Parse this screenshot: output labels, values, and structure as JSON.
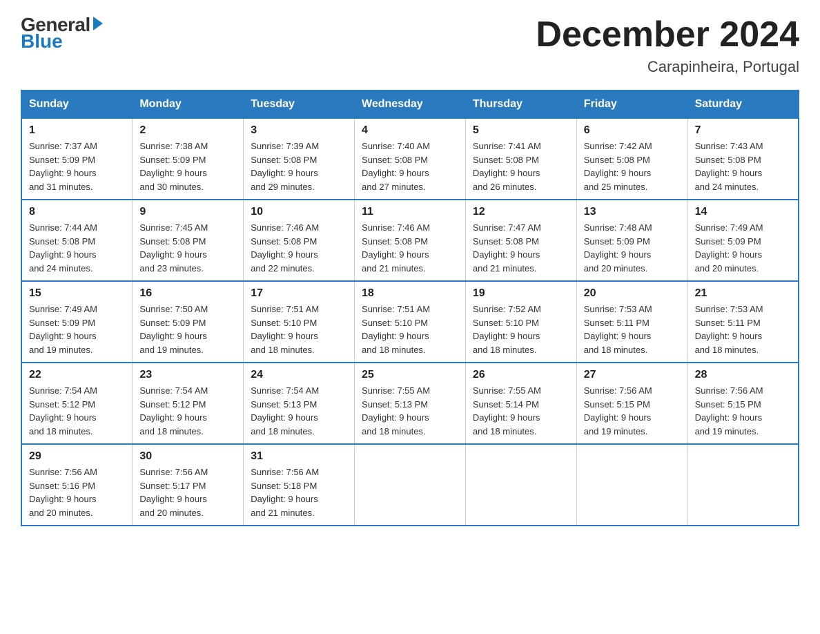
{
  "logo": {
    "general": "General",
    "blue": "Blue"
  },
  "title": "December 2024",
  "subtitle": "Carapinheira, Portugal",
  "days_header": [
    "Sunday",
    "Monday",
    "Tuesday",
    "Wednesday",
    "Thursday",
    "Friday",
    "Saturday"
  ],
  "weeks": [
    [
      {
        "day": "1",
        "sunrise": "7:37 AM",
        "sunset": "5:09 PM",
        "daylight": "9 hours and 31 minutes."
      },
      {
        "day": "2",
        "sunrise": "7:38 AM",
        "sunset": "5:09 PM",
        "daylight": "9 hours and 30 minutes."
      },
      {
        "day": "3",
        "sunrise": "7:39 AM",
        "sunset": "5:08 PM",
        "daylight": "9 hours and 29 minutes."
      },
      {
        "day": "4",
        "sunrise": "7:40 AM",
        "sunset": "5:08 PM",
        "daylight": "9 hours and 27 minutes."
      },
      {
        "day": "5",
        "sunrise": "7:41 AM",
        "sunset": "5:08 PM",
        "daylight": "9 hours and 26 minutes."
      },
      {
        "day": "6",
        "sunrise": "7:42 AM",
        "sunset": "5:08 PM",
        "daylight": "9 hours and 25 minutes."
      },
      {
        "day": "7",
        "sunrise": "7:43 AM",
        "sunset": "5:08 PM",
        "daylight": "9 hours and 24 minutes."
      }
    ],
    [
      {
        "day": "8",
        "sunrise": "7:44 AM",
        "sunset": "5:08 PM",
        "daylight": "9 hours and 24 minutes."
      },
      {
        "day": "9",
        "sunrise": "7:45 AM",
        "sunset": "5:08 PM",
        "daylight": "9 hours and 23 minutes."
      },
      {
        "day": "10",
        "sunrise": "7:46 AM",
        "sunset": "5:08 PM",
        "daylight": "9 hours and 22 minutes."
      },
      {
        "day": "11",
        "sunrise": "7:46 AM",
        "sunset": "5:08 PM",
        "daylight": "9 hours and 21 minutes."
      },
      {
        "day": "12",
        "sunrise": "7:47 AM",
        "sunset": "5:08 PM",
        "daylight": "9 hours and 21 minutes."
      },
      {
        "day": "13",
        "sunrise": "7:48 AM",
        "sunset": "5:09 PM",
        "daylight": "9 hours and 20 minutes."
      },
      {
        "day": "14",
        "sunrise": "7:49 AM",
        "sunset": "5:09 PM",
        "daylight": "9 hours and 20 minutes."
      }
    ],
    [
      {
        "day": "15",
        "sunrise": "7:49 AM",
        "sunset": "5:09 PM",
        "daylight": "9 hours and 19 minutes."
      },
      {
        "day": "16",
        "sunrise": "7:50 AM",
        "sunset": "5:09 PM",
        "daylight": "9 hours and 19 minutes."
      },
      {
        "day": "17",
        "sunrise": "7:51 AM",
        "sunset": "5:10 PM",
        "daylight": "9 hours and 18 minutes."
      },
      {
        "day": "18",
        "sunrise": "7:51 AM",
        "sunset": "5:10 PM",
        "daylight": "9 hours and 18 minutes."
      },
      {
        "day": "19",
        "sunrise": "7:52 AM",
        "sunset": "5:10 PM",
        "daylight": "9 hours and 18 minutes."
      },
      {
        "day": "20",
        "sunrise": "7:53 AM",
        "sunset": "5:11 PM",
        "daylight": "9 hours and 18 minutes."
      },
      {
        "day": "21",
        "sunrise": "7:53 AM",
        "sunset": "5:11 PM",
        "daylight": "9 hours and 18 minutes."
      }
    ],
    [
      {
        "day": "22",
        "sunrise": "7:54 AM",
        "sunset": "5:12 PM",
        "daylight": "9 hours and 18 minutes."
      },
      {
        "day": "23",
        "sunrise": "7:54 AM",
        "sunset": "5:12 PM",
        "daylight": "9 hours and 18 minutes."
      },
      {
        "day": "24",
        "sunrise": "7:54 AM",
        "sunset": "5:13 PM",
        "daylight": "9 hours and 18 minutes."
      },
      {
        "day": "25",
        "sunrise": "7:55 AM",
        "sunset": "5:13 PM",
        "daylight": "9 hours and 18 minutes."
      },
      {
        "day": "26",
        "sunrise": "7:55 AM",
        "sunset": "5:14 PM",
        "daylight": "9 hours and 18 minutes."
      },
      {
        "day": "27",
        "sunrise": "7:56 AM",
        "sunset": "5:15 PM",
        "daylight": "9 hours and 19 minutes."
      },
      {
        "day": "28",
        "sunrise": "7:56 AM",
        "sunset": "5:15 PM",
        "daylight": "9 hours and 19 minutes."
      }
    ],
    [
      {
        "day": "29",
        "sunrise": "7:56 AM",
        "sunset": "5:16 PM",
        "daylight": "9 hours and 20 minutes."
      },
      {
        "day": "30",
        "sunrise": "7:56 AM",
        "sunset": "5:17 PM",
        "daylight": "9 hours and 20 minutes."
      },
      {
        "day": "31",
        "sunrise": "7:56 AM",
        "sunset": "5:18 PM",
        "daylight": "9 hours and 21 minutes."
      },
      null,
      null,
      null,
      null
    ]
  ],
  "labels": {
    "sunrise": "Sunrise:",
    "sunset": "Sunset:",
    "daylight": "Daylight:"
  }
}
